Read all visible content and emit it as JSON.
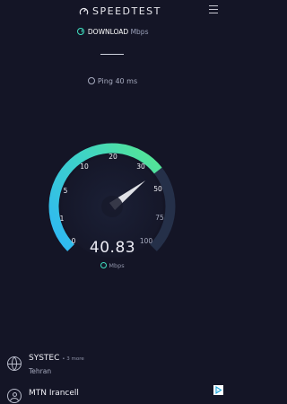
{
  "header": {
    "brand": "SPEEDTEST",
    "brand_icon": "speedometer-logo-icon",
    "menu_icon": "hamburger-menu-icon"
  },
  "test": {
    "label": "DOWNLOAD",
    "unit": "Mbps",
    "ping": "Ping 40 ms"
  },
  "gauge": {
    "ticks": [
      "0",
      "1",
      "5",
      "10",
      "20",
      "30",
      "50",
      "75",
      "100"
    ],
    "current_value": "40.83",
    "current_numeric": 40.83,
    "unit": "Mbps",
    "colors": {
      "arc_start": "#2fb9f2",
      "arc_end": "#52e39c",
      "track": "#253049"
    }
  },
  "isp": {
    "name": "SYSTEC",
    "more": "• 3 more",
    "location": "Tehran"
  },
  "server": {
    "name": "MTN Irancell"
  },
  "ad_icon": "ad-choices-icon"
}
